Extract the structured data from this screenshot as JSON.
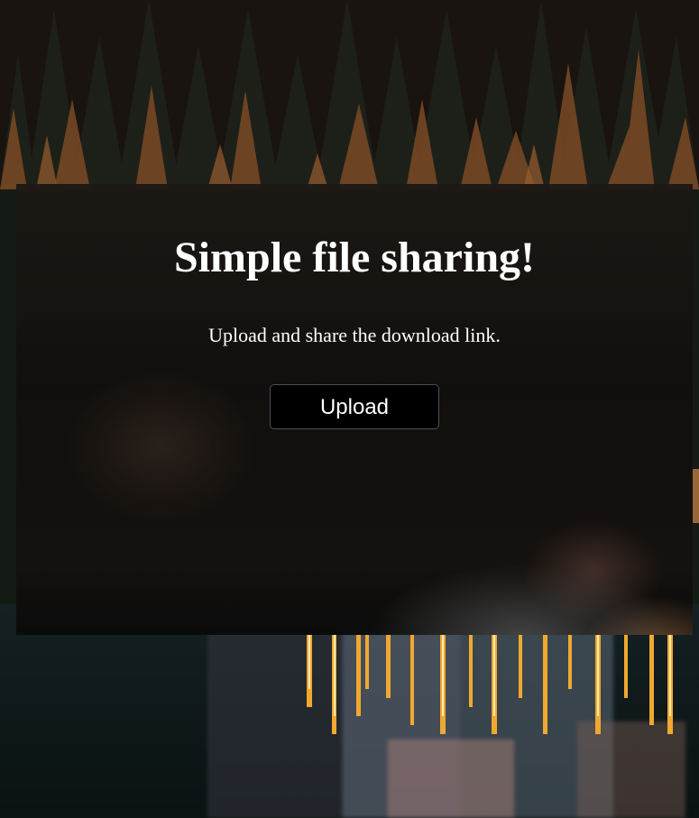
{
  "hero": {
    "title": "Simple file sharing!",
    "subtitle": "Upload and share the download link."
  },
  "actions": {
    "upload_label": "Upload"
  },
  "colors": {
    "text": "#ffffff",
    "button_bg": "#000000",
    "button_border": "#4a5058"
  }
}
